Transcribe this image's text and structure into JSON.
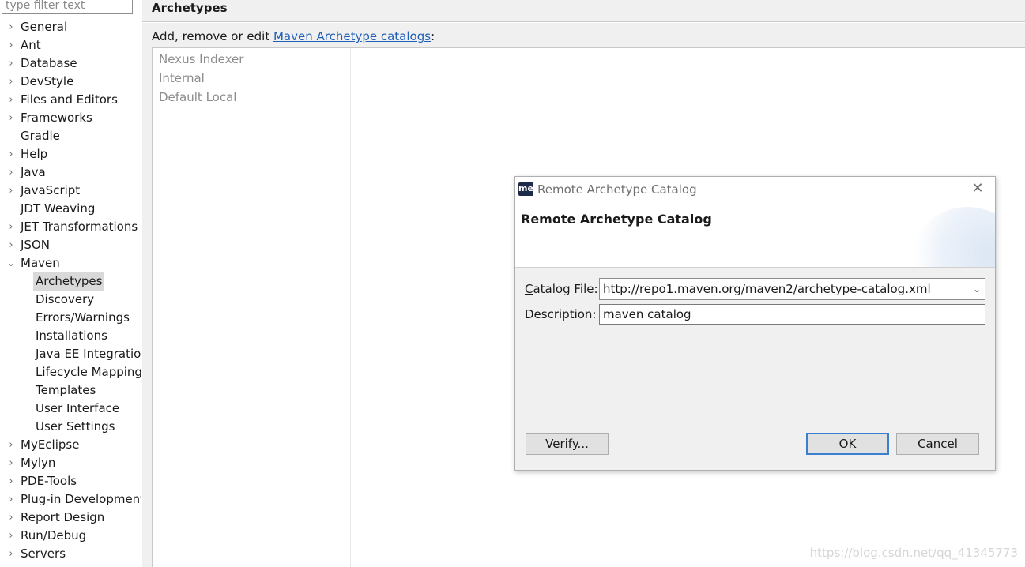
{
  "sidebar": {
    "filter_placeholder": "type filter text",
    "items": [
      {
        "label": "General",
        "expander": "›"
      },
      {
        "label": "Ant",
        "expander": "›"
      },
      {
        "label": "Database",
        "expander": "›"
      },
      {
        "label": "DevStyle",
        "expander": "›"
      },
      {
        "label": "Files and Editors",
        "expander": "›"
      },
      {
        "label": "Frameworks",
        "expander": "›"
      },
      {
        "label": "Gradle",
        "expander": ""
      },
      {
        "label": "Help",
        "expander": "›"
      },
      {
        "label": "Java",
        "expander": "›"
      },
      {
        "label": "JavaScript",
        "expander": "›"
      },
      {
        "label": "JDT Weaving",
        "expander": ""
      },
      {
        "label": "JET Transformations",
        "expander": "›"
      },
      {
        "label": "JSON",
        "expander": "›"
      },
      {
        "label": "Maven",
        "expander": "⌄"
      },
      {
        "label": "Archetypes",
        "child": true,
        "selected": true
      },
      {
        "label": "Discovery",
        "child": true
      },
      {
        "label": "Errors/Warnings",
        "child": true
      },
      {
        "label": "Installations",
        "child": true
      },
      {
        "label": "Java EE Integration",
        "child": true
      },
      {
        "label": "Lifecycle Mappings",
        "child": true
      },
      {
        "label": "Templates",
        "child": true
      },
      {
        "label": "User Interface",
        "child": true
      },
      {
        "label": "User Settings",
        "child": true
      },
      {
        "label": "MyEclipse",
        "expander": "›"
      },
      {
        "label": "Mylyn",
        "expander": "›"
      },
      {
        "label": "PDE-Tools",
        "expander": "›"
      },
      {
        "label": "Plug-in Development",
        "expander": "›"
      },
      {
        "label": "Report Design",
        "expander": "›"
      },
      {
        "label": "Run/Debug",
        "expander": "›"
      },
      {
        "label": "Servers",
        "expander": "›"
      }
    ]
  },
  "page": {
    "title": "Archetypes",
    "description_prefix": "Add, remove or edit ",
    "description_link": "Maven Archetype catalogs",
    "description_suffix": ":",
    "catalogs": [
      "Nexus Indexer",
      "Internal",
      "Default Local"
    ]
  },
  "dialog": {
    "app_icon": "me",
    "window_title": "Remote Archetype Catalog",
    "close_glyph": "✕",
    "banner_title": "Remote Archetype Catalog",
    "catalog_file_mnemonic": "C",
    "catalog_file_label_rest": "atalog File:",
    "catalog_file_value": "http://repo1.maven.org/maven2/archetype-catalog.xml",
    "description_label": "Description:",
    "description_value": "maven catalog",
    "verify_mnemonic": "V",
    "verify_rest": "erify...",
    "ok_label": "OK",
    "cancel_label": "Cancel"
  },
  "watermark": "https://blog.csdn.net/qq_41345773"
}
